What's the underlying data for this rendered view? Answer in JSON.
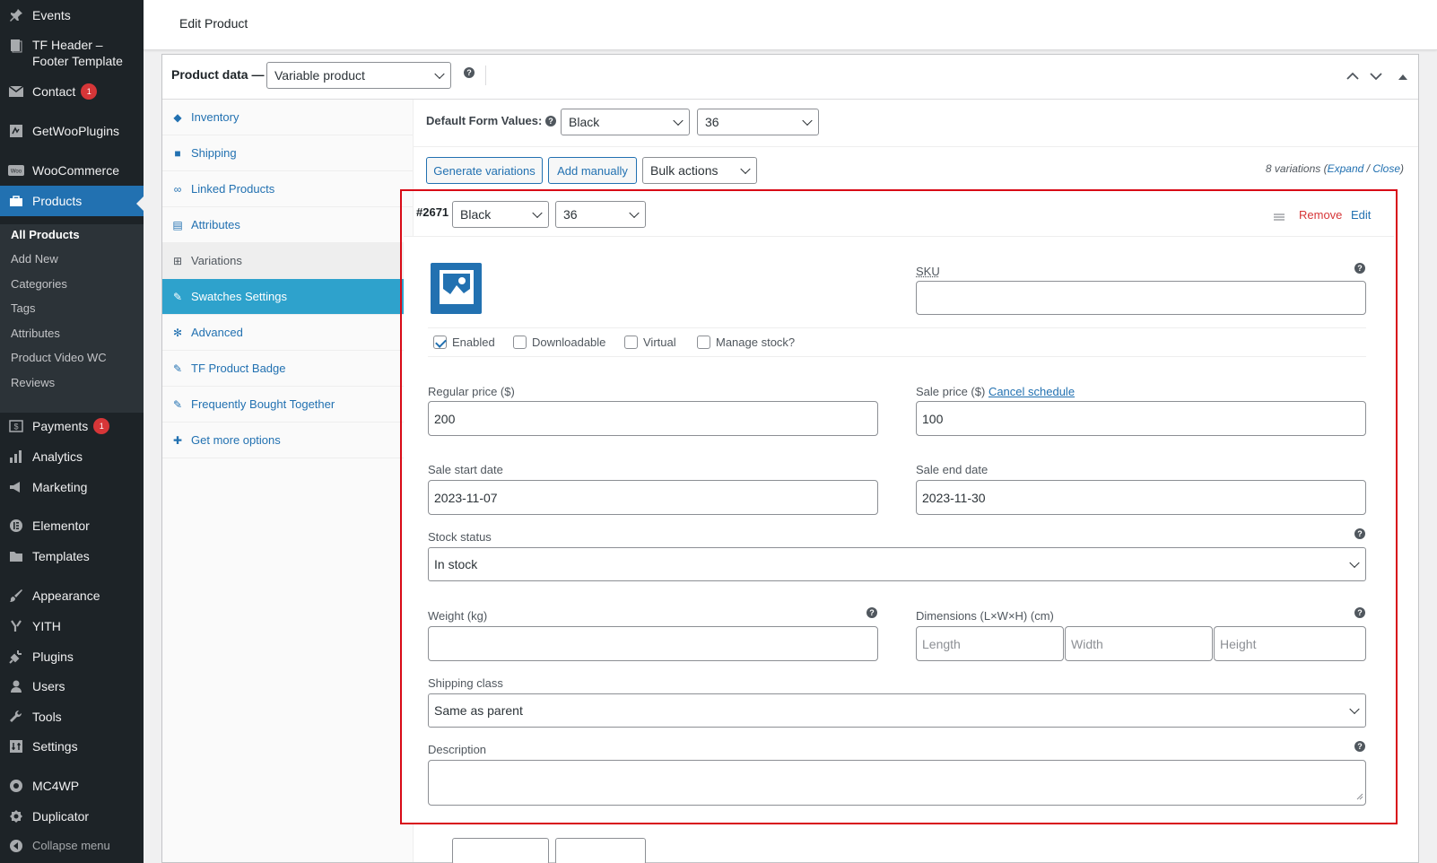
{
  "sidebar": {
    "items": [
      {
        "label": "Events",
        "icon": "pin-icon"
      },
      {
        "label": "TF Header – Footer Template",
        "icon": "page-icon"
      },
      {
        "label": "Contact",
        "icon": "mail-icon",
        "badge": "1"
      },
      {
        "label": "GetWooPlugins",
        "icon": "plugin-icon"
      },
      {
        "label": "WooCommerce",
        "icon": "woo-icon"
      },
      {
        "label": "Products",
        "icon": "products-icon"
      },
      {
        "label": "Payments",
        "icon": "payments-icon",
        "badge": "1"
      },
      {
        "label": "Analytics",
        "icon": "analytics-icon"
      },
      {
        "label": "Marketing",
        "icon": "megaphone-icon"
      },
      {
        "label": "Elementor",
        "icon": "elementor-icon"
      },
      {
        "label": "Templates",
        "icon": "folder-icon"
      },
      {
        "label": "Appearance",
        "icon": "brush-icon"
      },
      {
        "label": "YITH",
        "icon": "yith-icon"
      },
      {
        "label": "Plugins",
        "icon": "plug-icon"
      },
      {
        "label": "Users",
        "icon": "user-icon"
      },
      {
        "label": "Tools",
        "icon": "wrench-icon"
      },
      {
        "label": "Settings",
        "icon": "settings-icon"
      },
      {
        "label": "MC4WP",
        "icon": "mc4wp-icon"
      },
      {
        "label": "Duplicator",
        "icon": "duplicator-icon"
      },
      {
        "label": "Collapse menu",
        "icon": "collapse-icon"
      }
    ],
    "submenu": [
      "All Products",
      "Add New",
      "Categories",
      "Tags",
      "Attributes",
      "Product Video WC",
      "Reviews"
    ]
  },
  "header": {
    "title": "Edit Product"
  },
  "product_data": {
    "label": "Product data —",
    "type_value": "Variable product",
    "help": "?"
  },
  "tabs": [
    {
      "label": "Inventory",
      "icon": "tag-icon"
    },
    {
      "label": "Shipping",
      "icon": "truck-icon"
    },
    {
      "label": "Linked Products",
      "icon": "link-icon"
    },
    {
      "label": "Attributes",
      "icon": "list-icon"
    },
    {
      "label": "Variations",
      "icon": "grid-icon"
    },
    {
      "label": "Swatches Settings",
      "icon": "wrench-icon"
    },
    {
      "label": "Advanced",
      "icon": "gear-icon"
    },
    {
      "label": "TF Product Badge",
      "icon": "wrench-icon"
    },
    {
      "label": "Frequently Bought Together",
      "icon": "wrench-icon"
    },
    {
      "label": "Get more options",
      "icon": "plugin-icon"
    }
  ],
  "defaults": {
    "label": "Default Form Values:",
    "color": "Black",
    "size": "36"
  },
  "actions": {
    "generate": "Generate variations",
    "add_manually": "Add manually",
    "bulk": "Bulk actions",
    "count_text": "8 variations (",
    "expand": "Expand",
    "sep": " / ",
    "close": "Close",
    "count_end": ")"
  },
  "variation": {
    "id": "#2671",
    "color": "Black",
    "size": "36",
    "remove": "Remove",
    "edit": "Edit",
    "sku_label": "SKU",
    "enabled": "Enabled",
    "downloadable": "Downloadable",
    "virtual": "Virtual",
    "manage_stock": "Manage stock?",
    "regular_price_label": "Regular price ($)",
    "regular_price": "200",
    "sale_price_label": "Sale price ($)",
    "cancel_schedule": "Cancel schedule",
    "sale_price": "100",
    "sale_start_label": "Sale start date",
    "sale_start": "2023-11-07",
    "sale_end_label": "Sale end date",
    "sale_end": "2023-11-30",
    "stock_status_label": "Stock status",
    "stock_status": "In stock",
    "weight_label": "Weight (kg)",
    "dimensions_label": "Dimensions (L×W×H) (cm)",
    "length_ph": "Length",
    "width_ph": "Width",
    "height_ph": "Height",
    "shipping_class_label": "Shipping class",
    "shipping_class": "Same as parent",
    "description_label": "Description"
  },
  "colors": {
    "sidebar": "#1d2327",
    "accent": "#2271b1",
    "active_tab": "#2ea2cc",
    "highlight": "#d80a16",
    "badge": "#d63638"
  }
}
